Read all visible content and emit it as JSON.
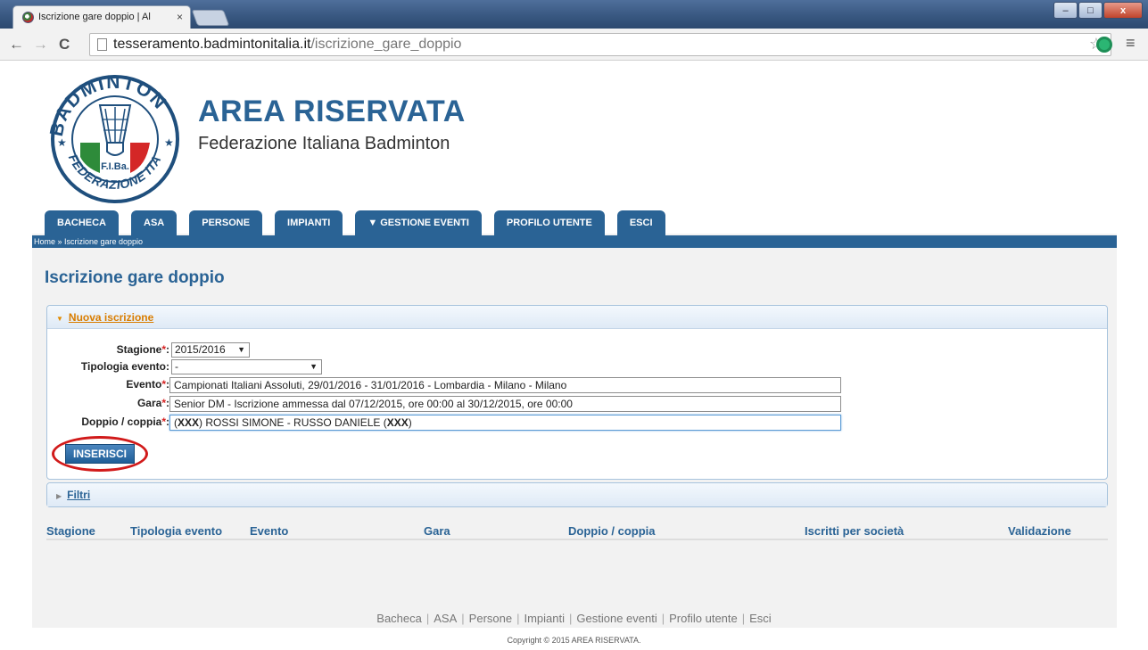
{
  "browser": {
    "tab_title": "Iscrizione gare doppio | Al",
    "tab_close": "×",
    "url_host": "tesseramento.badmintonitalia.it",
    "url_path": "/iscrizione_gare_doppio",
    "back_glyph": "←",
    "forward_glyph": "→",
    "reload_glyph": "C",
    "star_glyph": "☆",
    "menu_glyph": "≡",
    "win_min": "–",
    "win_max": "□",
    "win_close": "x",
    "icons": [
      "back-arrow-icon",
      "forward-arrow-icon",
      "reload-icon",
      "page-icon",
      "star-icon",
      "extension-icon",
      "menu-icon"
    ]
  },
  "site": {
    "title": "AREA RISERVATA",
    "subtitle": "Federazione Italiana Badminton",
    "logo_text_top": "BADMINTON",
    "logo_text_bottom": "FEDERAZIONE ITALIANA",
    "logo_initials": "F.I.Ba."
  },
  "nav": {
    "tabs": [
      {
        "label": "BACHECA"
      },
      {
        "label": "ASA"
      },
      {
        "label": "PERSONE"
      },
      {
        "label": "IMPIANTI"
      },
      {
        "label": "▼ GESTIONE EVENTI"
      },
      {
        "label": "PROFILO UTENTE"
      },
      {
        "label": "ESCI"
      }
    ]
  },
  "breadcrumb": "Home » Iscrizione gare doppio",
  "page_title": "Iscrizione gare doppio",
  "panel_new": {
    "title": "Nuova iscrizione",
    "caret": "▼",
    "stagione_label": "Stagione",
    "stagione_value": "2015/2016",
    "tipologia_label": "Tipologia evento:",
    "tipologia_value": "-",
    "evento_label": "Evento",
    "evento_value": "Campionati Italiani Assoluti, 29/01/2016 - 31/01/2016 - Lombardia - Milano - Milano",
    "gara_label": "Gara",
    "gara_value": "Senior DM - Iscrizione ammessa dal 07/12/2015, ore 00:00 al 30/12/2015, ore 00:00",
    "doppio_label": "Doppio / coppia",
    "doppio_prefix": "(",
    "doppio_code1": "XXX",
    "doppio_middle": ") ROSSI SIMONE - RUSSO DANIELE (",
    "doppio_code2": "XXX",
    "doppio_suffix": ")",
    "required_mark": "*",
    "colon": ":",
    "select_arrow": "▼",
    "insert_button": "INSERISCI"
  },
  "panel_filters": {
    "title": "Filtri",
    "caret": "▶"
  },
  "table": {
    "columns": [
      "Stagione",
      "Tipologia evento",
      "Evento",
      "Gara",
      "Doppio / coppia",
      "Iscritti per società",
      "Validazione"
    ]
  },
  "footer": {
    "links": [
      "Bacheca",
      "ASA",
      "Persone",
      "Impianti",
      "Gestione eventi",
      "Profilo utente",
      "Esci"
    ],
    "separator": "|",
    "copyright": "Copyright © 2015 AREA RISERVATA."
  },
  "colors": {
    "brand_blue": "#2a6395",
    "accent_orange": "#d97d00",
    "required_red": "#d62222",
    "highlight_red": "#d11a1a"
  }
}
